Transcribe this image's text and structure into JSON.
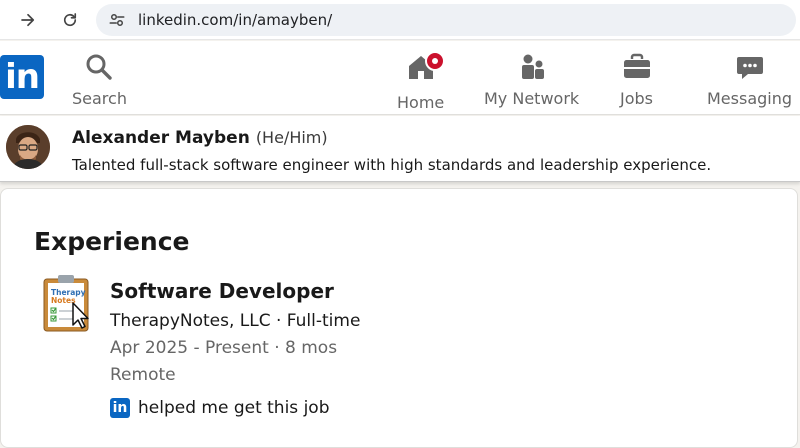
{
  "browser": {
    "url": "linkedin.com/in/amayben/"
  },
  "header": {
    "logo_text": "in",
    "nav": [
      {
        "label": "Search",
        "icon": "search-icon"
      },
      {
        "label": "Home",
        "icon": "home-icon",
        "has_notification": true
      },
      {
        "label": "My Network",
        "icon": "network-icon"
      },
      {
        "label": "Jobs",
        "icon": "briefcase-icon"
      },
      {
        "label": "Messaging",
        "icon": "messaging-icon"
      }
    ]
  },
  "profile": {
    "name": "Alexander Mayben",
    "pronouns": "(He/Him)",
    "headline": "Talented full-stack software engineer with high standards and leadership experience."
  },
  "experience": {
    "section_title": "Experience",
    "items": [
      {
        "title": "Software Developer",
        "company": "TherapyNotes, LLC · Full-time",
        "dates": "Apr 2025 - Present · 8 mos",
        "location": "Remote",
        "logo_text_1": "Therapy",
        "logo_text_2": "Notes",
        "helped_text": "helped me get this job",
        "helped_logo_text": "in"
      }
    ]
  },
  "colors": {
    "brand": "#0a66c2",
    "badge": "#cb112d",
    "muted": "#666666"
  }
}
